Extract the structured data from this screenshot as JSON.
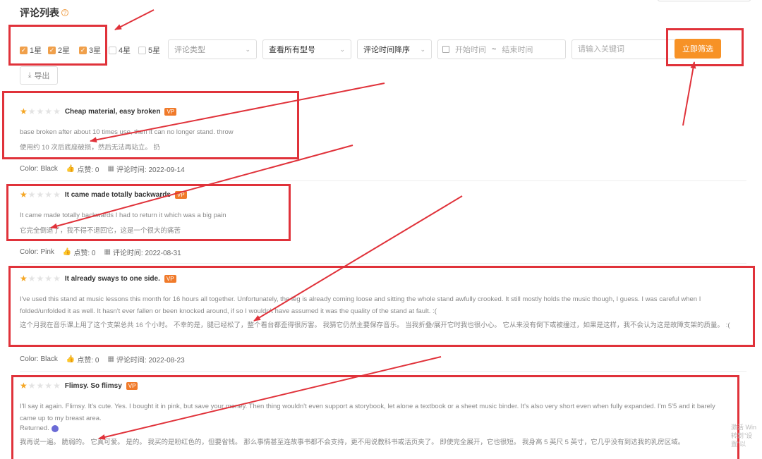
{
  "header": {
    "title": "评论列表",
    "help_icon": "question-circle-icon"
  },
  "filters": {
    "stars": [
      {
        "label": "1星",
        "checked": true
      },
      {
        "label": "2星",
        "checked": true
      },
      {
        "label": "3星",
        "checked": true
      },
      {
        "label": "4星",
        "checked": false
      },
      {
        "label": "5星",
        "checked": false
      }
    ],
    "review_type_placeholder": "评论类型",
    "model_value": "查看所有型号",
    "sort_value": "评论时间降序",
    "date_start_placeholder": "开始时间",
    "date_sep": "~",
    "date_end_placeholder": "结束时间",
    "keyword_placeholder": "请输入关键词",
    "filter_button": "立即筛选",
    "export_button": "导出"
  },
  "reviews": [
    {
      "rating": 1,
      "title": "Cheap material, easy broken",
      "badge": "VP",
      "text_en": "base broken after about 10 times use, then it can no longer stand. throw",
      "text_cn": "使用约 10 次后底座破损，然后无法再站立。 扔",
      "color": "Color: Black",
      "likes": "点赞: 0",
      "date": "评论时间: 2022-09-14"
    },
    {
      "rating": 1,
      "title": "It came made totally backwards",
      "badge": "VP",
      "text_en": "It came made totally backwards I had to return it which was a big pain",
      "text_cn": "它完全倒退了，我不得不退回它，这是一个很大的痛苦",
      "color": "Color: Pink",
      "likes": "点赞: 0",
      "date": "评论时间: 2022-08-31"
    },
    {
      "rating": 1,
      "title": "It already sways to one side.",
      "badge": "VP",
      "text_en": "I've used this stand at music lessons this month for 16 hours all together. Unfortunately, the leg is already coming loose and sitting the whole stand awfully crooked. It still mostly holds the music though, I guess. I was careful when I folded/unfolded it as well. It hasn't ever fallen or been knocked around, if so I wouldn't have assumed it was the quality of the stand at fault. :(",
      "text_cn": "这个月我在音乐课上用了这个支架总共 16 个小时。 不幸的是，腿已经松了，整个看台都歪得很厉害。 我猜它仍然主要保存音乐。 当我折叠/展开它时我也很小心。 它从来没有倒下或被撞过，如果是这样，我不会认为这是故障支架的质量。 :(",
      "color": "Color: Black",
      "likes": "点赞: 0",
      "date": "评论时间: 2022-08-23"
    },
    {
      "rating": 1,
      "title": "Flimsy. So flimsy",
      "badge": "VP",
      "text_en": "I'll say it again. Flimsy. It's cute. Yes. I bought it in pink, but save your money. Then thing wouldn't even support a storybook, let alone a textbook or a sheet music binder. It's also very short even when fully expanded. I'm 5'5 and it barely came up to my breast area.",
      "returned": "Returned.",
      "text_cn": "我再说一遍。 脆弱的。 它真可爱。 是的。 我买的是粉红色的，但要省钱。 那么事情甚至连故事书都不会支持，更不用说教科书或活页夹了。 即使完全展开，它也很短。 我身高 5 英尺 5 英寸，它几乎没有到达我的乳房区域。"
    }
  ],
  "watermark": {
    "line1": "激活 Win",
    "line2": "转到\"设置\"以"
  },
  "colors": {
    "accent": "#f79226",
    "annotation": "#e0323a",
    "star": "#f5a623",
    "badge": "#f07a2a"
  }
}
